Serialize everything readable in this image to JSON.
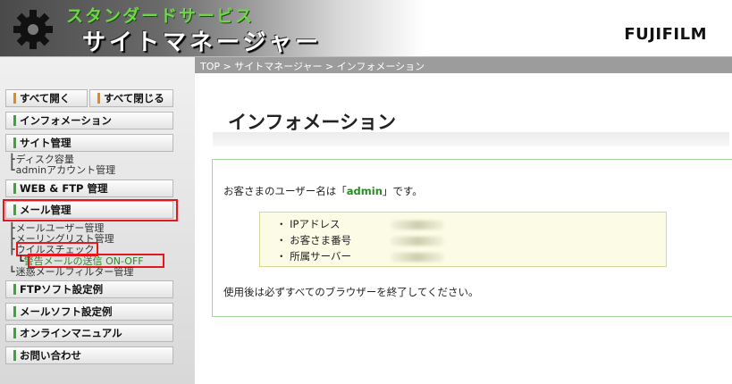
{
  "header": {
    "brand_sub": "スタンダードサービス",
    "brand_main": "サイトマネージャー",
    "logo_text": "FUJIFILM",
    "icon": "gear-icon"
  },
  "breadcrumb": "TOP > サイトマネージャー > インフォメーション",
  "sidebar": {
    "open_all": "すべて開く",
    "close_all": "すべて閉じる",
    "info": "インフォメーション",
    "site_admin": "サイト管理",
    "disk": "ディスク容量",
    "admin_account": "adminアカウント管理",
    "web_ftp": "WEB & FTP 管理",
    "mail_admin": "メール管理",
    "mail_user": "メールユーザー管理",
    "mailing_list": "メーリングリスト管理",
    "virus_check": "ウイルスチェック",
    "warning_mail": "警告メールの送信 ON-OFF",
    "spam_filter": "迷惑メールフィルター管理",
    "ftp_soft": "FTPソフト設定例",
    "mail_soft": "メールソフト設定例",
    "online_manual": "オンラインマニュアル",
    "contact": "お問い合わせ"
  },
  "main": {
    "title": "インフォメーション",
    "username_prefix": "お客さまのユーザー名は「",
    "username": "admin",
    "username_suffix": "」です。",
    "details": [
      {
        "label": "・ IPアドレス"
      },
      {
        "label": "・ お客さま番号"
      },
      {
        "label": "・ 所属サーバー"
      }
    ],
    "logout_note": "使用後は必ずすべてのブラウザーを終了してください。"
  },
  "colors": {
    "accent_green": "#3aa53a",
    "highlight_red": "#e8141e",
    "box_border": "#a8d6a0",
    "detail_bg": "#fcfce6"
  }
}
